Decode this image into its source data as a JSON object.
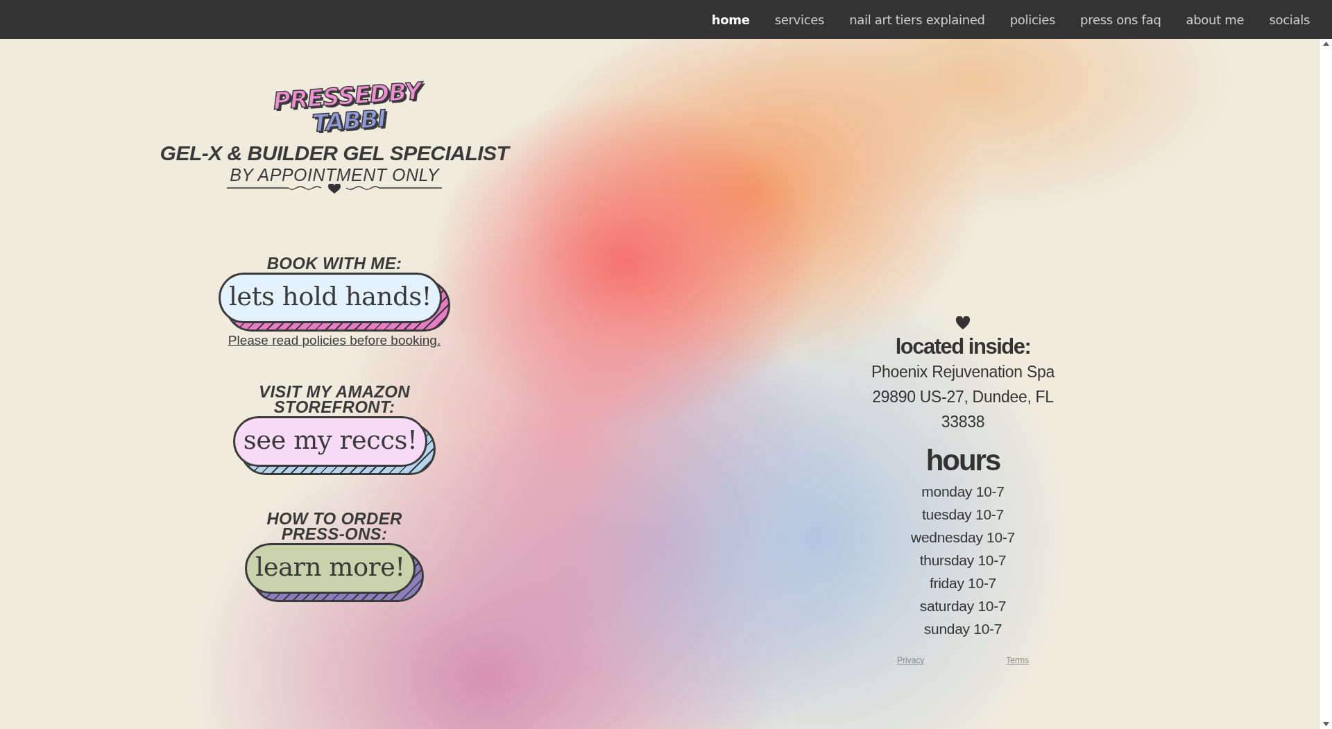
{
  "nav": [
    {
      "label": "home",
      "selected": true
    },
    {
      "label": "services",
      "selected": false
    },
    {
      "label": "nail art tiers explained",
      "selected": false
    },
    {
      "label": "policies",
      "selected": false
    },
    {
      "label": "press ons faq",
      "selected": false
    },
    {
      "label": "about me",
      "selected": false
    },
    {
      "label": "socials",
      "selected": false
    }
  ],
  "logo": {
    "line_1": "PRESSEDBY",
    "line_2": "TABBI"
  },
  "tagline": "GEL-X & BUILDER GEL SPECIALIST",
  "subtitle": "BY APPOINTMENT ONLY",
  "sections": [
    {
      "title": "BOOK WITH ME:",
      "button": {
        "label": "lets hold hands!",
        "color": "#e3f2fc",
        "stripe": {
          "color": "#e87cc4"
        }
      },
      "note": "Please read policies before booking."
    },
    {
      "title": "VISIT MY AMAZON STOREFRONT:",
      "button": {
        "label": "see my reccs!",
        "color": "#f8dcf7",
        "stripe": {
          "color": "#b3d4ec"
        }
      }
    },
    {
      "title": "HOW TO ORDER PRESS-ONS:",
      "button": {
        "label": "learn more!",
        "color": "#c8d2ab",
        "stripe": {
          "color": "#8a7fbc"
        }
      }
    }
  ],
  "location": {
    "heading": "located inside:",
    "lines": [
      "Phoenix Rejuvenation Spa",
      "29890 US-27, Dundee, FL",
      "33838"
    ]
  },
  "hours": {
    "heading": "hours",
    "days": [
      "monday 10-7",
      "tuesday 10-7",
      "wednesday 10-7",
      "thursday 10-7",
      "friday 10-7",
      "saturday 10-7",
      "sunday 10-7"
    ]
  },
  "footer_links": [
    "Privacy",
    "Terms"
  ]
}
